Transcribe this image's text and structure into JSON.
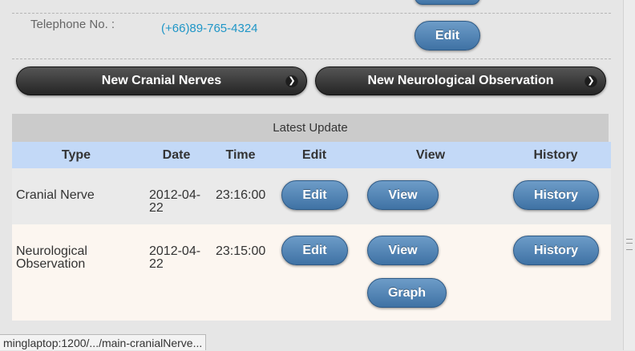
{
  "contact": {
    "telephone_label": "Telephone No. :",
    "telephone_value": "(+66)89-765-4324",
    "edit_label": "Edit"
  },
  "actions": {
    "new_cranial_nerves": "New Cranial Nerves",
    "new_neuro_observation": "New Neurological Observation"
  },
  "latest_update": {
    "title": "Latest Update",
    "headers": {
      "type": "Type",
      "date": "Date",
      "time": "Time",
      "edit": "Edit",
      "view": "View",
      "history": "History"
    },
    "rows": [
      {
        "type": "Cranial Nerve",
        "date": "2012-04-22",
        "time": "23:16:00",
        "edit": "Edit",
        "view": "View",
        "history": "History"
      },
      {
        "type": "Neurological Observation",
        "date": "2012-04-22",
        "time": "23:15:00",
        "edit": "Edit",
        "view": "View",
        "history": "History",
        "graph": "Graph"
      }
    ]
  },
  "status_bar": {
    "url": "minglaptop:1200/.../main-cranialNerve..."
  },
  "colors": {
    "link": "#1f96c7",
    "button_blue": "#3f72a4",
    "header_row": "#c3d9f7"
  }
}
